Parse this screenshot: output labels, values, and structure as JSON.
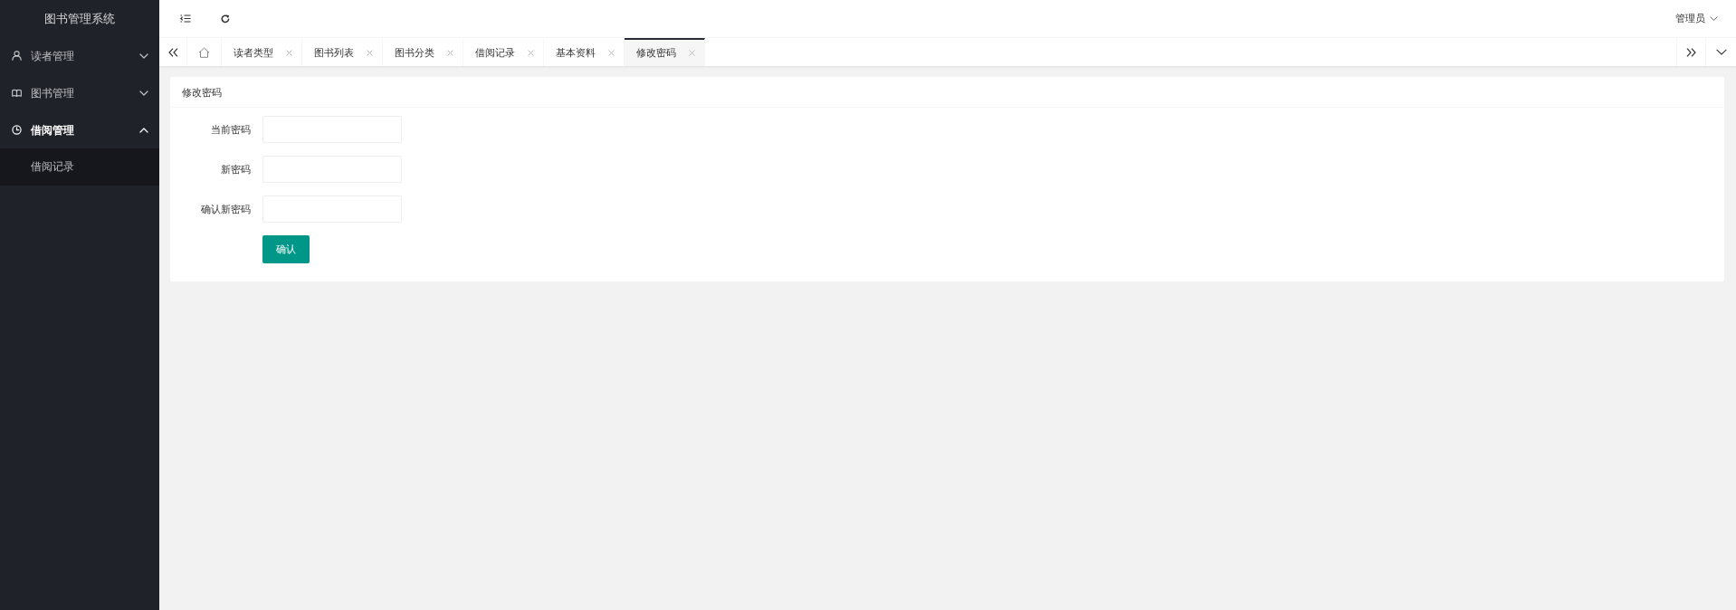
{
  "sidebar": {
    "title": "图书管理系统",
    "items": [
      {
        "label": "读者管理",
        "expanded": false
      },
      {
        "label": "图书管理",
        "expanded": false
      },
      {
        "label": "借阅管理",
        "expanded": true,
        "children": [
          {
            "label": "借阅记录",
            "selected": false
          }
        ]
      }
    ]
  },
  "header": {
    "user": "管理员"
  },
  "tabs": [
    {
      "label": "读者类型",
      "selected": false
    },
    {
      "label": "图书列表",
      "selected": false
    },
    {
      "label": "图书分类",
      "selected": false
    },
    {
      "label": "借阅记录",
      "selected": false
    },
    {
      "label": "基本资料",
      "selected": false
    },
    {
      "label": "修改密码",
      "selected": true
    }
  ],
  "card": {
    "title": "修改密码",
    "fields": [
      {
        "label": "当前密码"
      },
      {
        "label": "新密码"
      },
      {
        "label": "确认新密码"
      }
    ],
    "submit": "确认"
  }
}
